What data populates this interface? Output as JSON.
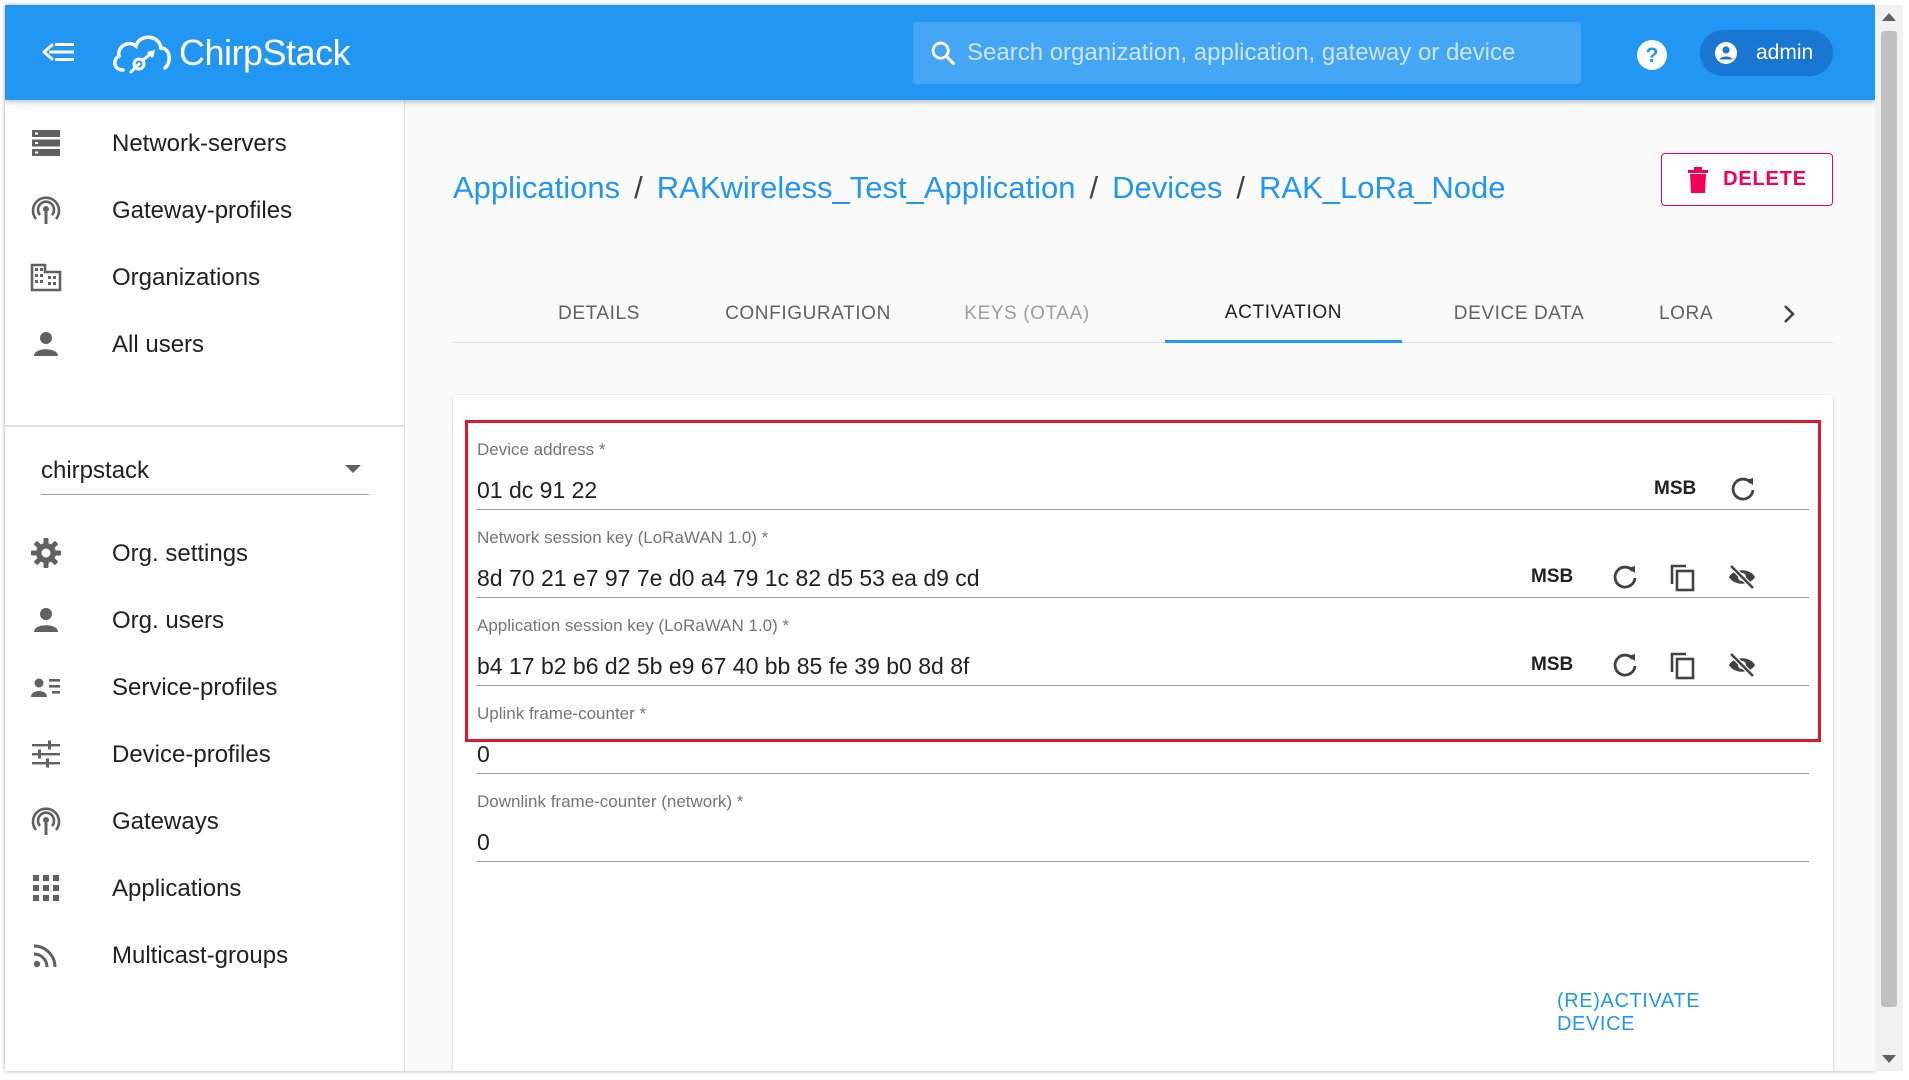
{
  "header": {
    "brand": "ChirpStack",
    "search_placeholder": "Search organization, application, gateway or device",
    "user": "admin"
  },
  "sidebar": {
    "global_items": [
      {
        "label": "Network-servers",
        "icon": "server-icon"
      },
      {
        "label": "Gateway-profiles",
        "icon": "antenna-icon"
      },
      {
        "label": "Organizations",
        "icon": "building-icon"
      },
      {
        "label": "All users",
        "icon": "person-icon"
      }
    ],
    "organization": "chirpstack",
    "org_items": [
      {
        "label": "Org. settings",
        "icon": "gear-icon"
      },
      {
        "label": "Org. users",
        "icon": "person-icon"
      },
      {
        "label": "Service-profiles",
        "icon": "contact-list-icon"
      },
      {
        "label": "Device-profiles",
        "icon": "sliders-icon"
      },
      {
        "label": "Gateways",
        "icon": "antenna-icon"
      },
      {
        "label": "Applications",
        "icon": "grid-icon"
      },
      {
        "label": "Multicast-groups",
        "icon": "rss-icon"
      }
    ]
  },
  "breadcrumb": [
    "Applications",
    "RAKwireless_Test_Application",
    "Devices",
    "RAK_LoRa_Node"
  ],
  "delete_label": "DELETE",
  "tabs": [
    {
      "label": "DETAILS"
    },
    {
      "label": "CONFIGURATION"
    },
    {
      "label": "KEYS (OTAA)"
    },
    {
      "label": "ACTIVATION"
    },
    {
      "label": "DEVICE DATA"
    },
    {
      "label": "LORA"
    }
  ],
  "active_tab": "ACTIVATION",
  "form": {
    "device_address": {
      "label": "Device address *",
      "value": "01 dc 91 22",
      "byte_order": "MSB"
    },
    "nwk_s_key": {
      "label": "Network session key (LoRaWAN 1.0) *",
      "value": "8d 70 21 e7 97 7e d0 a4 79 1c 82 d5 53 ea d9 cd",
      "byte_order": "MSB"
    },
    "app_s_key": {
      "label": "Application session key (LoRaWAN 1.0) *",
      "value": "b4 17 b2 b6 d2 5b e9 67 40 bb 85 fe 39 b0 8d 8f",
      "byte_order": "MSB"
    },
    "f_cnt_up": {
      "label": "Uplink frame-counter *",
      "value": "0"
    },
    "n_f_cnt_down": {
      "label": "Downlink frame-counter (network) *",
      "value": "0"
    }
  },
  "activate_label": "(RE)ACTIVATE DEVICE",
  "colors": {
    "primary": "#2196f3",
    "danger": "#f50057",
    "annotation": "#e0192a"
  }
}
